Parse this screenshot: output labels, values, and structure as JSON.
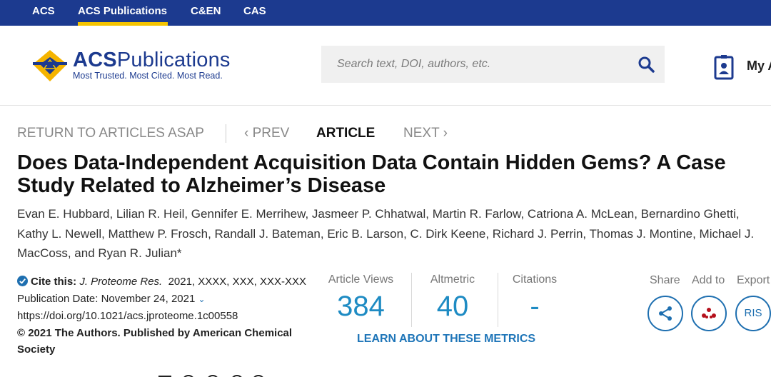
{
  "topnav": {
    "items": [
      "ACS",
      "ACS Publications",
      "C&EN",
      "CAS"
    ],
    "active_index": 1
  },
  "logo": {
    "title_bold": "ACS",
    "title_rest": "Publications",
    "tagline": "Most Trusted. Most Cited. Most Read."
  },
  "search": {
    "placeholder": "Search text, DOI, authors, etc."
  },
  "account": {
    "label": "My A"
  },
  "article_nav": {
    "return": "RETURN TO ARTICLES ASAP",
    "prev": "‹ PREV",
    "current": "ARTICLE",
    "next": "NEXT ›"
  },
  "article": {
    "title": "Does Data-Independent Acquisition Data Contain Hidden Gems? A Case Study Related to Alzheimer’s Disease",
    "authors": "Evan E. Hubbard, Lilian R. Heil, Gennifer E. Merrihew, Jasmeer P. Chhatwal, Martin R. Farlow, Catriona A. McLean, Bernardino Ghetti, Kathy L. Newell, Matthew P. Frosch, Randall J. Bateman, Eric B. Larson, C. Dirk Keene, Richard J. Perrin, Thomas J. Montine, Michael J. MacCoss, and Ryan R. Julian*"
  },
  "cite": {
    "label": "Cite this:",
    "journal": "J. Proteome Res.",
    "ref": "2021, XXXX, XXX, XXX-XXX",
    "pub_date": "Publication Date: November 24, 2021",
    "doi": "https://doi.org/10.1021/acs.jproteome.1c00558",
    "copyright": "© 2021 The Authors. Published by American Chemical Society"
  },
  "metrics": {
    "views_label": "Article Views",
    "views_value": "384",
    "altmetric_label": "Altmetric",
    "altmetric_value": "40",
    "citations_label": "Citations",
    "citations_value": "-",
    "learn_more": "LEARN ABOUT THESE METRICS"
  },
  "tools": {
    "share_label": "Share",
    "add_label": "Add to",
    "export_label": "Export",
    "ris_label": "RIS"
  },
  "colors": {
    "nav_blue": "#1c3a8f",
    "accent_yellow": "#f5c400",
    "metric_blue": "#1e8bc3"
  }
}
